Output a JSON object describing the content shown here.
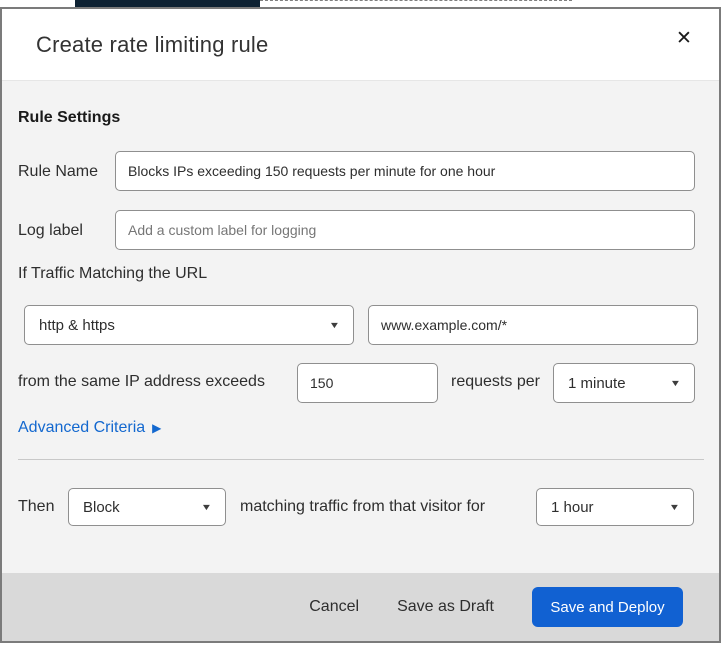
{
  "dialog": {
    "title": "Create rate limiting rule"
  },
  "icons": {
    "close": "✕",
    "caret_down": "▼",
    "caret_right": "▶"
  },
  "form": {
    "section_heading": "Rule Settings",
    "rule_name": {
      "label": "Rule Name",
      "value": "Blocks IPs exceeding 150 requests per minute for one hour"
    },
    "log_label": {
      "label": "Log label",
      "placeholder": "Add a custom label for logging"
    },
    "match": {
      "intro": "If Traffic Matching the URL",
      "scheme_selected": "http & https",
      "url_value": "www.example.com/*"
    },
    "threshold": {
      "prefix": "from the same IP address exceeds",
      "requests_value": "150",
      "middle": "requests per",
      "period_selected": "1 minute"
    },
    "advanced_link": "Advanced Criteria",
    "action": {
      "prefix": "Then",
      "action_selected": "Block",
      "middle": "matching traffic from that visitor for",
      "duration_selected": "1 hour"
    }
  },
  "footer": {
    "cancel": "Cancel",
    "save_draft": "Save as Draft",
    "save_deploy": "Save and Deploy"
  },
  "colors": {
    "accent_blue": "#1161d2",
    "link_blue": "#1368cf",
    "top_bar_navy": "#0e2233",
    "body_gray": "#f3f3f3",
    "footer_gray": "#d9d9d9"
  }
}
